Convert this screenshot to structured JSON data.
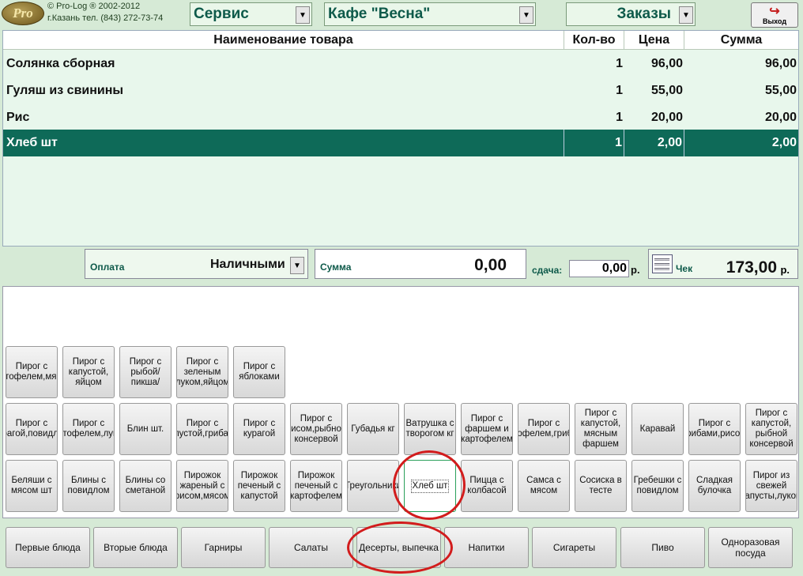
{
  "header": {
    "logo_text": "Pro",
    "copyright": "© Pro-Log ® 2002-2012",
    "contact": "г.Казань тел. (843) 272-73-74",
    "service_combo": "Сервис",
    "cafe_combo": "Кафе \"Весна\"",
    "orders_combo": "Заказы",
    "exit_label": "Выход",
    "dropdown_icon": "▼"
  },
  "table": {
    "columns": [
      "Наименование товара",
      "Кол-во",
      "Цена",
      "Сумма"
    ],
    "rows": [
      {
        "name": "Солянка сборная",
        "qty": "1",
        "price": "96,00",
        "sum": "96,00"
      },
      {
        "name": "Гуляш из свинины",
        "qty": "1",
        "price": "55,00",
        "sum": "55,00"
      },
      {
        "name": "Рис",
        "qty": "1",
        "price": "20,00",
        "sum": "20,00"
      },
      {
        "name": "Хлеб шт",
        "qty": "1",
        "price": "2,00",
        "sum": "2,00"
      }
    ],
    "selected_row": 3
  },
  "payment": {
    "method_label": "Оплата",
    "method_value": "Наличными",
    "sum_label": "Сумма",
    "sum_value": "0,00",
    "change_label": "сдача:",
    "change_value": "0,00",
    "change_unit": "р.",
    "check_label": "Чек",
    "check_value": "173,00",
    "check_unit": "р."
  },
  "goods": {
    "row1": [
      "Пирог с картофелем,мясом",
      "Пирог с капустой, яйцом",
      "Пирог с рыбой/пикша/",
      "Пирог с зеленым луком,яйцом",
      "Пирог с яблоками"
    ],
    "row2": [
      "Пирог с курагой,повидлом",
      "Пирог с картофелем,луком",
      "Блин шт.",
      "Пирог с капустой,грибами",
      "Пирог с курагой",
      "Пирог с рисом,рыбной консервой",
      "Губадья кг",
      "Ватрушка с творогом кг",
      "Пирог с фаршем и картофелем",
      "Пирог с картофелем,грибами",
      "Пирог с капустой, мясным фаршем",
      "Каравай",
      "Пирог с грибами,рисом",
      "Пирог с капустой, рыбной консервой"
    ],
    "row3": [
      "Беляши с мясом шт",
      "Блины с повидлом",
      "Блины со сметаной",
      "Пирожок жареный с рисом,мясом",
      "Пирожок печеный с капустой",
      "Пирожок печеный с картофелем",
      "Треугольники",
      "Хлеб шт",
      "Пицца с колбасой",
      "Самса с мясом",
      "Сосиска в тесте",
      "Гребешки с повидлом",
      "Сладкая булочка",
      "Пирог из свежей капусты,луком"
    ],
    "selected": "Хлеб шт"
  },
  "categories": [
    "Первые блюда",
    "Вторые блюда",
    "Гарниры",
    "Салаты",
    "Десерты, выпечка",
    "Напитки",
    "Сигареты",
    "Пиво",
    "Одноразовая посуда"
  ],
  "colors": {
    "accent": "#0e6a58",
    "background": "#d6ead6",
    "annotation": "#d21c1c"
  }
}
